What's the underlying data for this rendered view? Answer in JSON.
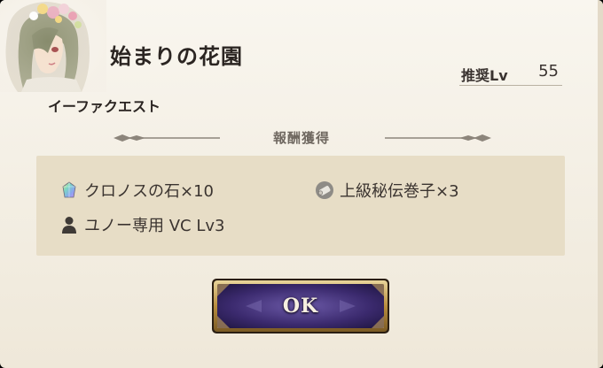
{
  "dialog": {
    "title": "始まりの花園",
    "subtitle": "イーファクエスト",
    "recommended_label": "推奨Lv",
    "recommended_level": "55"
  },
  "rewards": {
    "header": "報酬獲得",
    "items": [
      {
        "label": "クロノスの石×10",
        "icon": "chronos-stone-icon"
      },
      {
        "label": "上級秘伝巻子×3",
        "icon": "scroll-icon"
      },
      {
        "label": "ユノー専用 VC Lv3",
        "icon": "person-icon"
      }
    ]
  },
  "buttons": {
    "ok_label": "OK"
  },
  "colors": {
    "panel_background": "#f5f0e6",
    "reward_box": "#e7ddc6",
    "button_fill": "#3a2766",
    "button_border": "#c9a55a"
  }
}
